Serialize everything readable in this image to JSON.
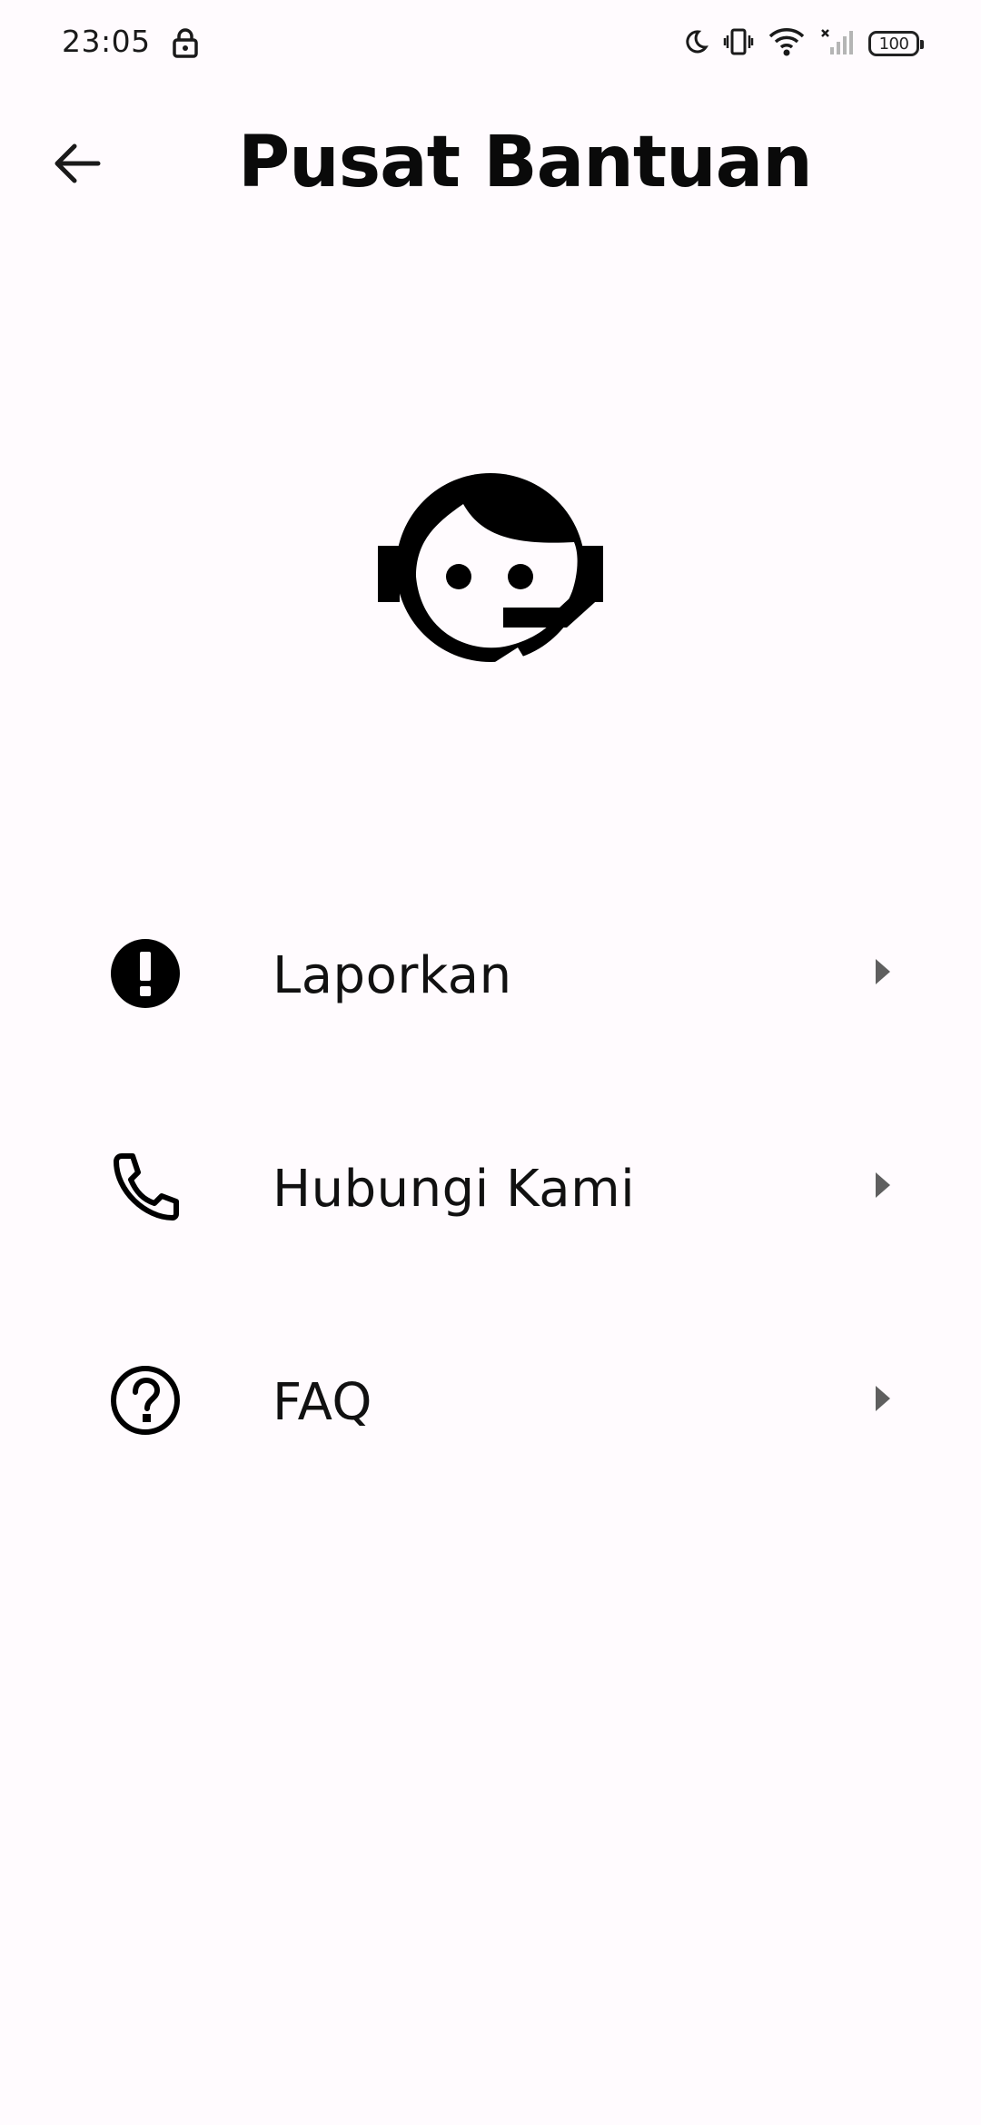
{
  "status_bar": {
    "time": "23:05",
    "battery": "100",
    "icons": [
      "lock-icon",
      "moon-icon",
      "vibrate-icon",
      "wifi-icon",
      "signal-icon",
      "battery-icon"
    ]
  },
  "header": {
    "title": "Pusat Bantuan",
    "back_icon": "arrow-back-icon"
  },
  "hero": {
    "icon": "support-agent-icon"
  },
  "menu": {
    "items": [
      {
        "label": "Laporkan",
        "icon": "report-icon"
      },
      {
        "label": "Hubungi Kami",
        "icon": "phone-icon"
      },
      {
        "label": "FAQ",
        "icon": "help-icon"
      }
    ]
  },
  "colors": {
    "background": "#fffbfe",
    "text": "#111111",
    "chevron": "#5f5f5f"
  }
}
